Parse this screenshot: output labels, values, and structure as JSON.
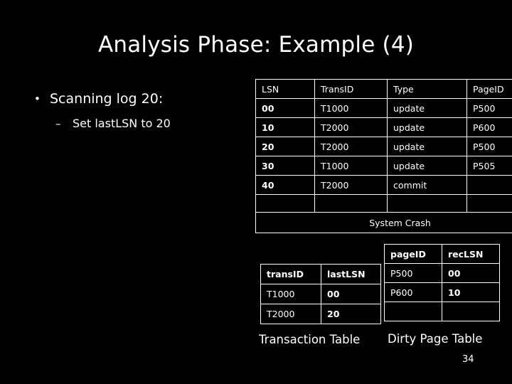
{
  "slide": {
    "title": "Analysis Phase: Example (4)",
    "number": "34"
  },
  "bullets": {
    "level1_marker": "•",
    "level1_text": "Scanning log 20:",
    "level2_marker": "–",
    "level2_text": "Set lastLSN to 20"
  },
  "log_table": {
    "headers": [
      "LSN",
      "TransID",
      "Type",
      "PageID"
    ],
    "rows": [
      {
        "cells": [
          "00",
          "T1000",
          "update",
          "P500"
        ],
        "highlight": false
      },
      {
        "cells": [
          "10",
          "T2000",
          "update",
          "P600"
        ],
        "highlight": false
      },
      {
        "cells": [
          "20",
          "T2000",
          "update",
          "P500"
        ],
        "highlight": true
      },
      {
        "cells": [
          "30",
          "T1000",
          "update",
          "P505"
        ],
        "highlight": false
      },
      {
        "cells": [
          "40",
          "T2000",
          "commit",
          ""
        ],
        "highlight": false
      },
      {
        "cells": [
          "",
          "",
          "",
          ""
        ],
        "highlight": false
      }
    ],
    "crash_label": "System Crash"
  },
  "transaction_table": {
    "caption": "Transaction Table",
    "headers": [
      "transID",
      "lastLSN"
    ],
    "rows": [
      {
        "cells": [
          "T1000",
          "00"
        ],
        "highlight": [
          false,
          false
        ]
      },
      {
        "cells": [
          "T2000",
          "20"
        ],
        "highlight": [
          false,
          true
        ]
      }
    ]
  },
  "dirty_page_table": {
    "caption": "Dirty Page Table",
    "headers": [
      "pageID",
      "recLSN"
    ],
    "rows": [
      {
        "cells": [
          "P500",
          "00"
        ],
        "highlight": [
          false,
          false
        ]
      },
      {
        "cells": [
          "P600",
          "10"
        ],
        "highlight": [
          false,
          false
        ]
      },
      {
        "cells": [
          "",
          ""
        ],
        "highlight": [
          false,
          false
        ]
      }
    ]
  },
  "colors": {
    "background": "#000000",
    "text": "#ffffff",
    "highlight": "#ffff99",
    "border": "#ffffff"
  }
}
